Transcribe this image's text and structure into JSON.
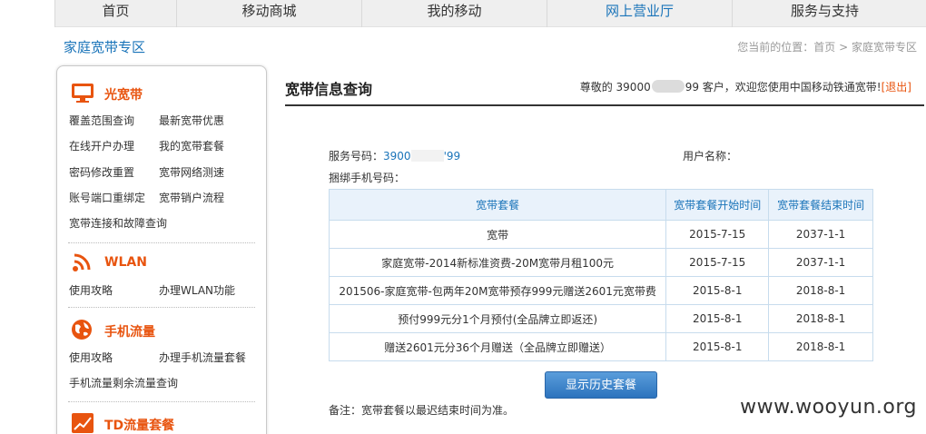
{
  "nav": {
    "items": [
      {
        "label": "首页"
      },
      {
        "label": "移动商城"
      },
      {
        "label": "我的移动"
      },
      {
        "label": "网上营业厅"
      },
      {
        "label": "服务与支持"
      }
    ],
    "active_color": "#1a74b9"
  },
  "section_title": "家庭宽带专区",
  "breadcrumb": {
    "prefix": "您当前的位置：",
    "home": "首页",
    "sep": ">",
    "current": "家庭宽带专区"
  },
  "sidebar": {
    "groups": [
      {
        "title": "光宽带",
        "icon": "monitor-icon",
        "links": [
          "覆盖范围查询",
          "最新宽带优惠",
          "在线开户办理",
          "我的宽带套餐",
          "密码修改重置",
          "宽带网络测速",
          "账号端口重绑定",
          "宽带销户流程",
          "宽带连接和故障查询"
        ]
      },
      {
        "title": "WLAN",
        "icon": "wifi-icon",
        "links": [
          "使用攻略",
          "办理WLAN功能"
        ]
      },
      {
        "title": "手机流量",
        "icon": "globe-icon",
        "links": [
          "使用攻略",
          "办理手机流量套餐",
          "手机流量剩余流量查询"
        ]
      },
      {
        "title": "TD流量套餐",
        "icon": "chart-icon",
        "links": []
      }
    ],
    "accent": "#e8540f"
  },
  "main": {
    "title": "宽带信息查询",
    "welcome_pre": "尊敬的 39000",
    "welcome_post": "99 客户，欢迎您使用中国移动铁通宽带!",
    "logout": "[退出]",
    "service_label": "服务号码：",
    "service_value_a": "3900",
    "service_value_b": "'99",
    "username_label": "用户名称：",
    "bound_phone_label": "捆绑手机号码："
  },
  "table": {
    "headers": [
      "宽带套餐",
      "宽带套餐开始时间",
      "宽带套餐结束时间"
    ],
    "rows": [
      [
        "宽带",
        "2015-7-15",
        "2037-1-1"
      ],
      [
        "家庭宽带-2014新标准资费-20M宽带月租100元",
        "2015-7-15",
        "2037-1-1"
      ],
      [
        "201506-家庭宽带-包两年20M宽带预存999元赠送2601元宽带费",
        "2015-8-1",
        "2018-8-1"
      ],
      [
        "预付999元分1个月预付(全品牌立即返还)",
        "2015-8-1",
        "2018-8-1"
      ],
      [
        "赠送2601元分36个月赠送（全品牌立即赠送）",
        "2015-8-1",
        "2018-8-1"
      ]
    ]
  },
  "history_button": "显示历史套餐",
  "note": "备注：宽带套餐以最迟结束时间为准。",
  "watermark": "www.wooyun.org"
}
